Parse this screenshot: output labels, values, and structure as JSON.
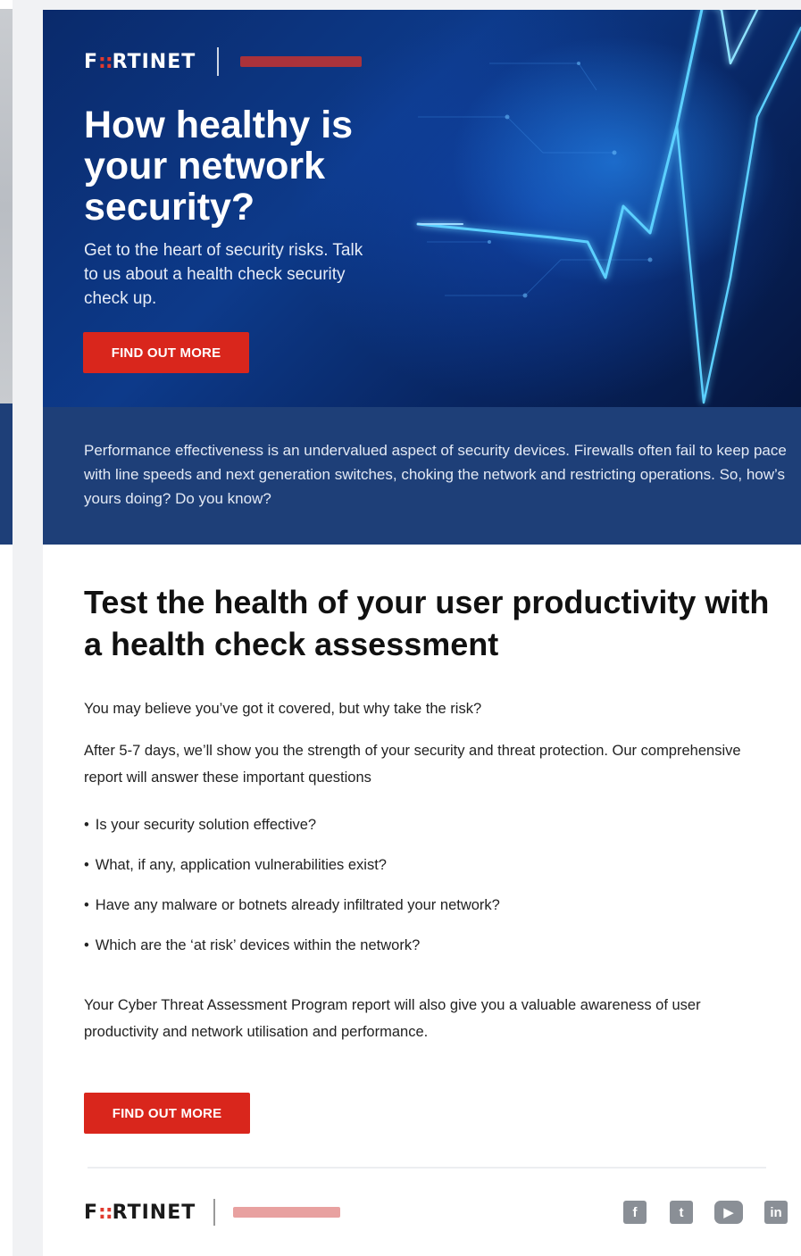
{
  "brand": {
    "logo_prefix": "F",
    "logo_mark": "::",
    "logo_suffix": "RTINET",
    "accent_color": "#d9261c",
    "navy_color": "#1e3f78"
  },
  "hero": {
    "title": "How healthy is your network security?",
    "subtitle": "Get to the heart of security risks. Talk to us about a health check security check up.",
    "cta_label": "FIND OUT MORE"
  },
  "band": {
    "text": "Performance effectiveness is an undervalued aspect of security devices. Firewalls often fail to keep pace with line speeds and next generation switches, choking the network and restricting operations. So, how’s yours doing? Do you know?"
  },
  "content": {
    "heading": "Test the health of your user productivity with a health check assessment",
    "intro": "You may believe you’ve got it covered, but why take the risk?",
    "para2": "After 5-7 days, we’ll show you the strength of your security and threat protection. Our comprehensive report will answer these important questions",
    "bullets": [
      "Is your security solution effective?",
      "What, if any, application vulnerabilities exist?",
      "Have any malware or botnets already infiltrated your network?",
      "Which are the ‘at risk’ devices within the network?"
    ],
    "para3": "Your Cyber Threat Assessment Program report will also give you a valuable awareness of user productivity and network utilisation and performance.",
    "cta_label": "FIND OUT MORE"
  },
  "footer": {
    "social_icons": [
      "facebook-icon",
      "twitter-icon",
      "youtube-icon",
      "linkedin-icon"
    ],
    "social_glyphs": {
      "facebook": "f",
      "twitter": "t",
      "youtube": "▶",
      "linkedin": "in"
    }
  }
}
